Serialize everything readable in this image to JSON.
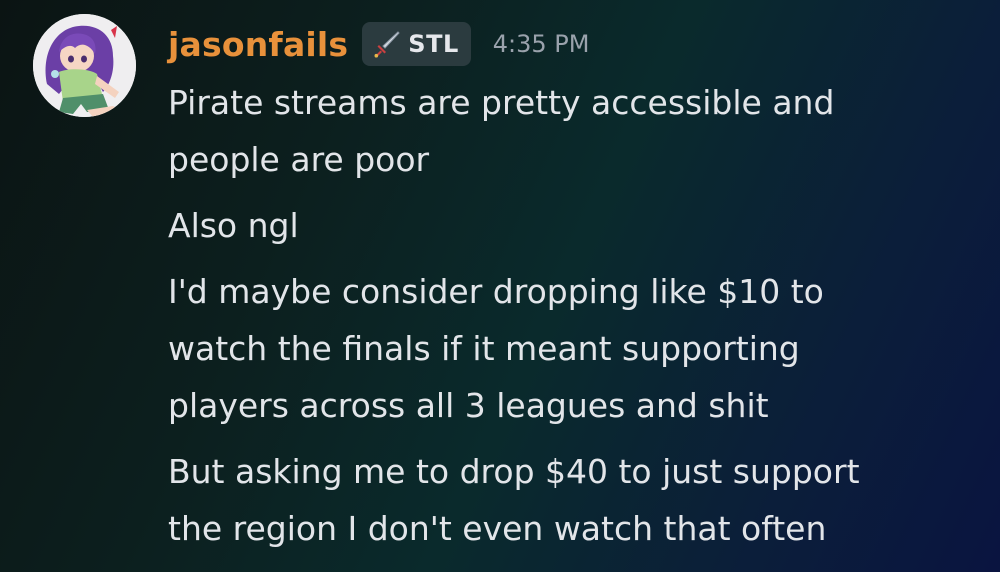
{
  "message": {
    "username": "jasonfails",
    "tag": {
      "icon": "sword-icon",
      "label": "STL"
    },
    "timestamp": "4:35 PM",
    "avatar": {
      "icon": "avatar-anime-character-icon"
    },
    "paragraphs": [
      {
        "lines": [
          "Pirate streams are pretty accessible and",
          "people are poor"
        ]
      },
      {
        "lines": [
          "Also ngl"
        ]
      },
      {
        "lines": [
          "I'd maybe consider dropping like $10 to",
          "watch the finals if it meant supporting",
          "players across all 3 leagues and shit"
        ]
      },
      {
        "lines": [
          "But asking me to drop $40 to just support",
          "the region I don't even watch that often"
        ]
      }
    ]
  },
  "colors": {
    "username": "#e8913b",
    "tag_background": "#2b3b3f",
    "timestamp": "#9aa2ac",
    "text": "#e2e5e9"
  }
}
